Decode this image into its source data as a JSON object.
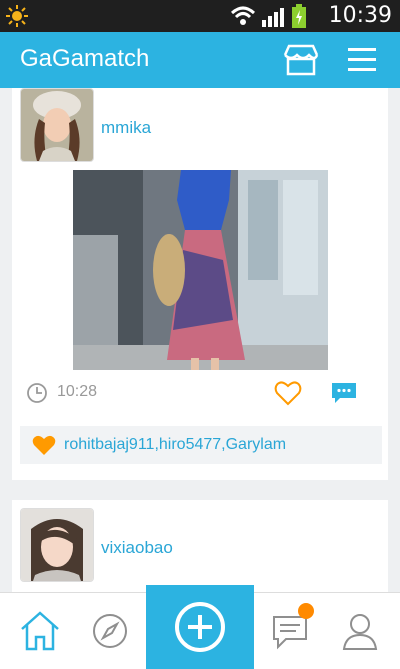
{
  "statusbar": {
    "time": "10:39"
  },
  "app": {
    "title": "GaGamatch"
  },
  "posts": [
    {
      "username": "mmika",
      "time": "10:28",
      "likers": "rohitbajaj911,hiro5477,Garylam"
    },
    {
      "username": "vixiaobao"
    }
  ],
  "colors": {
    "accent": "#2cb3e1",
    "like": "#ff9a00",
    "badge": "#ff8a00"
  },
  "icons": [
    "sun-icon",
    "wifi-icon",
    "signal-icon",
    "battery-icon",
    "store-icon",
    "menu-icon",
    "clock-icon",
    "heart-icon",
    "comment-icon",
    "home-icon",
    "compass-icon",
    "add-icon",
    "chat-icon",
    "profile-icon"
  ]
}
